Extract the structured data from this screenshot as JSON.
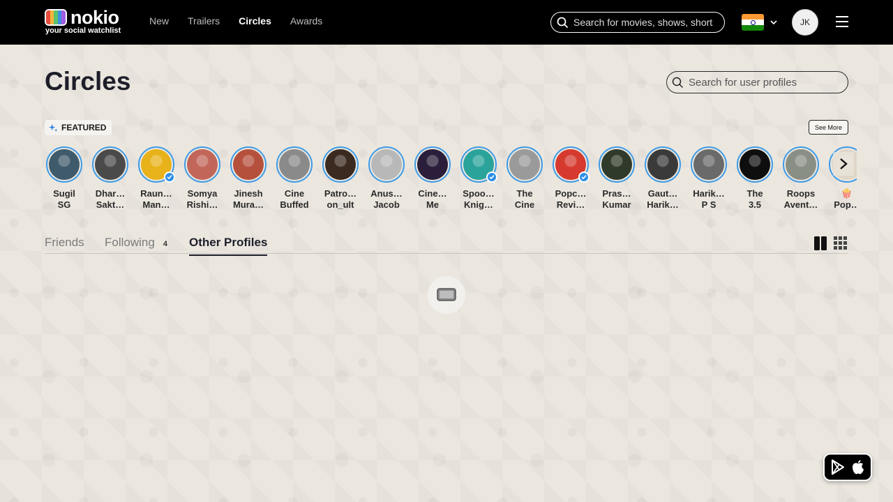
{
  "header": {
    "logo_word": "nokio",
    "logo_tagline": "your social watchlist",
    "nav": [
      {
        "label": "New",
        "active": false
      },
      {
        "label": "Trailers",
        "active": false
      },
      {
        "label": "Circles",
        "active": true
      },
      {
        "label": "Awards",
        "active": false
      }
    ],
    "search_placeholder": "Search for movies, shows, shorts",
    "user_initials": "JK"
  },
  "page": {
    "title": "Circles",
    "profile_search_placeholder": "Search for user profiles"
  },
  "featured": {
    "label": "FEATURED",
    "see_more": "See More",
    "profiles": [
      {
        "line1": "Sugil",
        "line2": "SG",
        "color": "#3f5a6b",
        "verified": false
      },
      {
        "line1": "Dhar…",
        "line2": "Sakt…",
        "color": "#4a4a4a",
        "verified": false
      },
      {
        "line1": "Raun…",
        "line2": "Man…",
        "color": "#e8b21a",
        "verified": true
      },
      {
        "line1": "Somya",
        "line2": "Rishi…",
        "color": "#c2665a",
        "verified": false
      },
      {
        "line1": "Jinesh",
        "line2": "Mura…",
        "color": "#b5503d",
        "verified": false
      },
      {
        "line1": "Cine",
        "line2": "Buffed",
        "color": "#8a8a8a",
        "verified": false
      },
      {
        "line1": "Patro…",
        "line2": "on_ult",
        "color": "#3a2a20",
        "verified": false
      },
      {
        "line1": "Anus…",
        "line2": "Jacob",
        "color": "#b8b8b8",
        "verified": false
      },
      {
        "line1": "Cine…",
        "line2": "Me",
        "color": "#2b1e3a",
        "verified": false
      },
      {
        "line1": "Spoo…",
        "line2": "Knig…",
        "color": "#2aa39a",
        "verified": true
      },
      {
        "line1": "The",
        "line2": "Cine",
        "color": "#9a9a9a",
        "verified": false
      },
      {
        "line1": "Popc…",
        "line2": "Revi…",
        "color": "#d63a2f",
        "verified": true
      },
      {
        "line1": "Pras…",
        "line2": "Kumar",
        "color": "#2f3a2a",
        "verified": false
      },
      {
        "line1": "Gaut…",
        "line2": "Harik…",
        "color": "#3a3a3a",
        "verified": false
      },
      {
        "line1": "Harik…",
        "line2": "P S",
        "color": "#6a6a6a",
        "verified": false
      },
      {
        "line1": "The",
        "line2": "3.5",
        "color": "#0e0e0e",
        "verified": false
      },
      {
        "line1": "Roops",
        "line2": "Avent…",
        "color": "#8a8f86",
        "verified": false
      },
      {
        "line1": "🍿",
        "line2": "Pop…",
        "color": "#e0d6c8",
        "verified": false
      }
    ]
  },
  "tabs": [
    {
      "label": "Friends",
      "count": "",
      "active": false
    },
    {
      "label": "Following",
      "count": "4",
      "active": false
    },
    {
      "label": "Other Profiles",
      "count": "",
      "active": true
    }
  ]
}
